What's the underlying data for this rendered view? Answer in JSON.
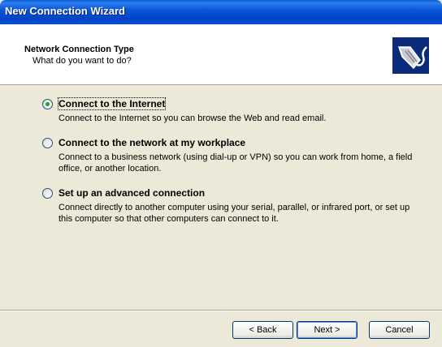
{
  "window": {
    "title": "New Connection Wizard"
  },
  "header": {
    "title": "Network Connection Type",
    "subtitle": "What do you want to do?",
    "icon": "network-cable-icon"
  },
  "options": [
    {
      "label": "Connect to the Internet",
      "description": "Connect to the Internet so you can browse the Web and read email.",
      "selected": true
    },
    {
      "label": "Connect to the network at my workplace",
      "description": "Connect to a business network (using dial-up or VPN) so you can work from home, a field office, or another location.",
      "selected": false
    },
    {
      "label": "Set up an advanced connection",
      "description": "Connect directly to another computer using your serial, parallel, or infrared port, or set up this computer so that other computers can connect to it.",
      "selected": false
    }
  ],
  "buttons": {
    "back": "< Back",
    "next": "Next >",
    "cancel": "Cancel"
  }
}
